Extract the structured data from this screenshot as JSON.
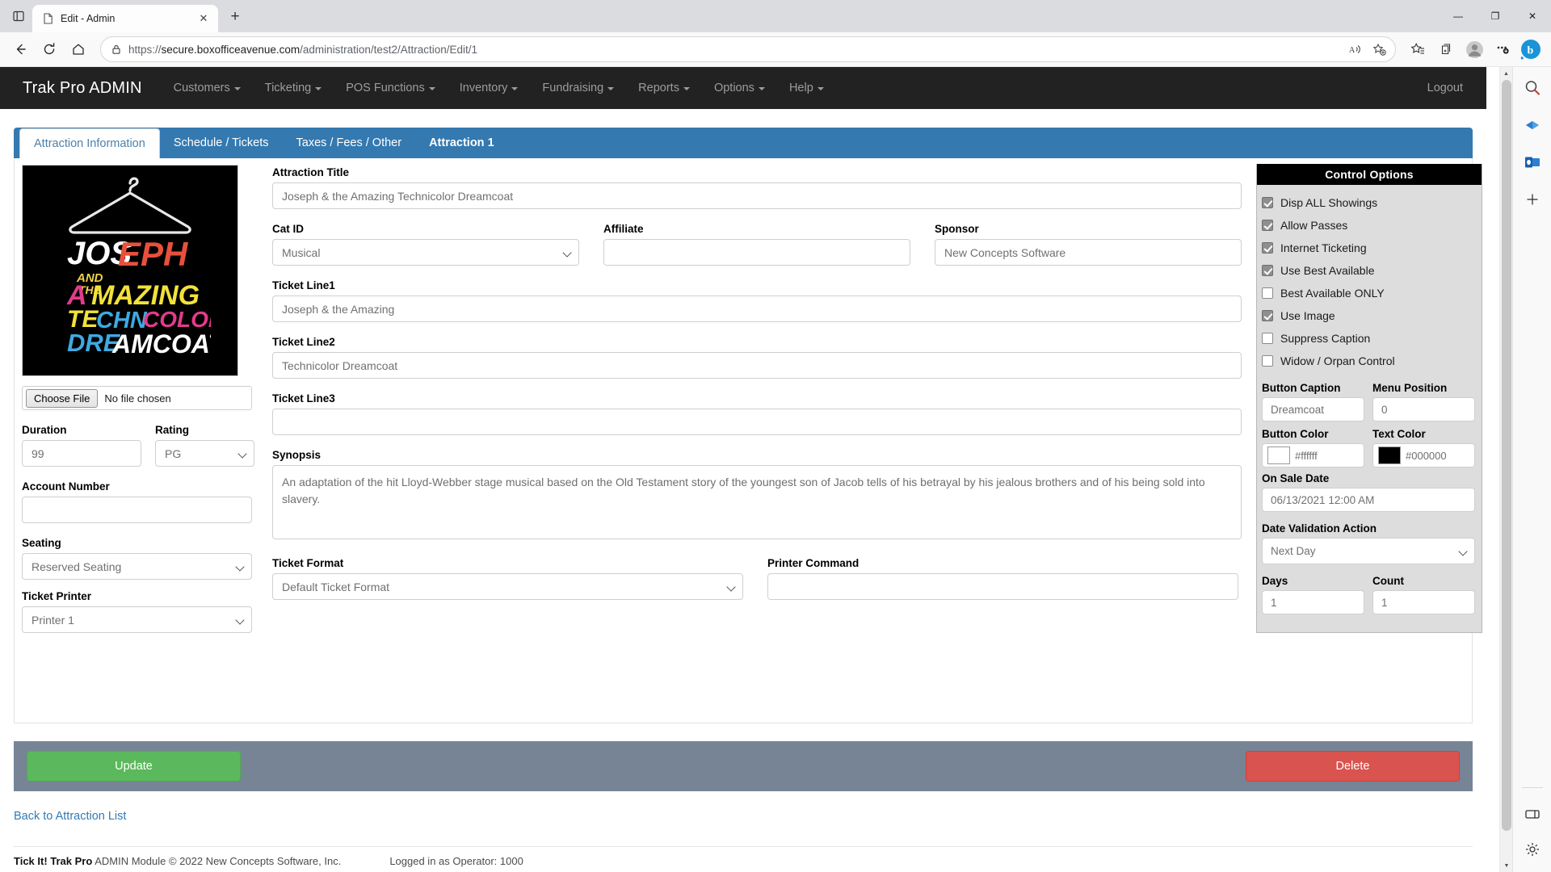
{
  "browser": {
    "tab_title": "Edit - Admin",
    "new_tab_label": "+",
    "close_tab_label": "✕",
    "url_protocol": "https://",
    "url_host": "secure.boxofficeavenue.com",
    "url_path": "/administration/test2/Attraction/Edit/1",
    "icons": {
      "tab_search": "tab-search-icon",
      "tab_favicon": "page-icon",
      "back": "back-arrow-icon",
      "refresh": "refresh-icon",
      "home": "home-icon",
      "lock": "lock-icon",
      "read_aloud": "read-aloud-icon",
      "add_favorite": "add-favorite-icon",
      "favorites": "favorites-icon",
      "collections": "collections-icon",
      "profile": "profile-avatar-icon",
      "settings_more": "more-settings-icon",
      "copilot": "copilot-bing-icon",
      "minimize": "—",
      "maximize": "❐",
      "close": "✕"
    },
    "sidebar_icons": [
      "search-icon",
      "office-icon",
      "outlook-icon",
      "add-sidebar-icon",
      "split-screen-icon",
      "sidebar-settings-icon"
    ]
  },
  "app": {
    "brand": "Trak Pro ADMIN",
    "logout_label": "Logout",
    "nav_items": [
      {
        "label": "Customers",
        "caret": true
      },
      {
        "label": "Ticketing",
        "caret": true
      },
      {
        "label": "POS Functions",
        "caret": true
      },
      {
        "label": "Inventory",
        "caret": true
      },
      {
        "label": "Fundraising",
        "caret": true
      },
      {
        "label": "Reports",
        "caret": true
      },
      {
        "label": "Options",
        "caret": true
      },
      {
        "label": "Help",
        "caret": true
      }
    ]
  },
  "tabs": [
    {
      "label": "Attraction Information",
      "active": true,
      "bold": false
    },
    {
      "label": "Schedule / Tickets",
      "active": false,
      "bold": false
    },
    {
      "label": "Taxes / Fees / Other",
      "active": false,
      "bold": false
    },
    {
      "label": "Attraction 1",
      "active": false,
      "bold": true
    }
  ],
  "left": {
    "poster_alt": "Joseph and the Amazing Technicolor Dreamcoat poster",
    "choose_file_label": "Choose File",
    "no_file_label": "No file chosen",
    "duration_label": "Duration",
    "duration_value": "99",
    "rating_label": "Rating",
    "rating_value": "PG",
    "account_number_label": "Account Number",
    "account_number_value": "",
    "seating_label": "Seating",
    "seating_value": "Reserved Seating",
    "ticket_printer_label": "Ticket Printer",
    "ticket_printer_value": "Printer 1"
  },
  "main": {
    "attraction_title_label": "Attraction Title",
    "attraction_title_value": "Joseph & the Amazing Technicolor Dreamcoat",
    "cat_id_label": "Cat ID",
    "cat_id_value": "Musical",
    "affiliate_label": "Affiliate",
    "affiliate_value": "",
    "sponsor_label": "Sponsor",
    "sponsor_value": "New Concepts Software",
    "ticket_line1_label": "Ticket Line1",
    "ticket_line1_value": "Joseph & the Amazing",
    "ticket_line2_label": "Ticket Line2",
    "ticket_line2_value": "Technicolor Dreamcoat",
    "ticket_line3_label": "Ticket Line3",
    "ticket_line3_value": "",
    "synopsis_label": "Synopsis",
    "synopsis_value": "An adaptation of the hit Lloyd-Webber stage musical based on the Old Testament story of the youngest son of Jacob tells of his betrayal by his jealous brothers and of his being sold into slavery.",
    "ticket_format_label": "Ticket Format",
    "ticket_format_value": "Default Ticket Format",
    "printer_command_label": "Printer Command",
    "printer_command_value": ""
  },
  "control_options": {
    "header": "Control Options",
    "checkboxes": [
      {
        "label": "Disp ALL Showings",
        "checked": true
      },
      {
        "label": "Allow Passes",
        "checked": true
      },
      {
        "label": "Internet Ticketing",
        "checked": true
      },
      {
        "label": "Use Best Available",
        "checked": true
      },
      {
        "label": "Best Available ONLY",
        "checked": false
      },
      {
        "label": "Use Image",
        "checked": true
      },
      {
        "label": "Suppress Caption",
        "checked": false
      },
      {
        "label": "Widow / Orpan Control",
        "checked": false
      }
    ],
    "button_caption_label": "Button Caption",
    "button_caption_value": "Dreamcoat",
    "menu_position_label": "Menu Position",
    "menu_position_value": "0",
    "button_color_label": "Button Color",
    "button_color_value": "#ffffff",
    "text_color_label": "Text Color",
    "text_color_value": "#000000",
    "on_sale_date_label": "On Sale Date",
    "on_sale_date_value": "06/13/2021 12:00 AM",
    "date_validation_label": "Date Validation Action",
    "date_validation_value": "Next Day",
    "days_label": "Days",
    "days_value": "1",
    "count_label": "Count",
    "count_value": "1"
  },
  "actions": {
    "update_label": "Update",
    "delete_label": "Delete",
    "back_link_label": "Back to Attraction List"
  },
  "footer": {
    "brand": "Tick It! Trak Pro",
    "copyright": "ADMIN Module © 2022  New Concepts Software, Inc.",
    "operator": "Logged in as Operator: 1000"
  },
  "colors": {
    "navbar_bg": "#222222",
    "tab_bar": "#3479b0",
    "update_btn": "#5cb85c",
    "delete_btn": "#d9534f",
    "actionbar_bg": "#768496",
    "link": "#337ab7"
  }
}
